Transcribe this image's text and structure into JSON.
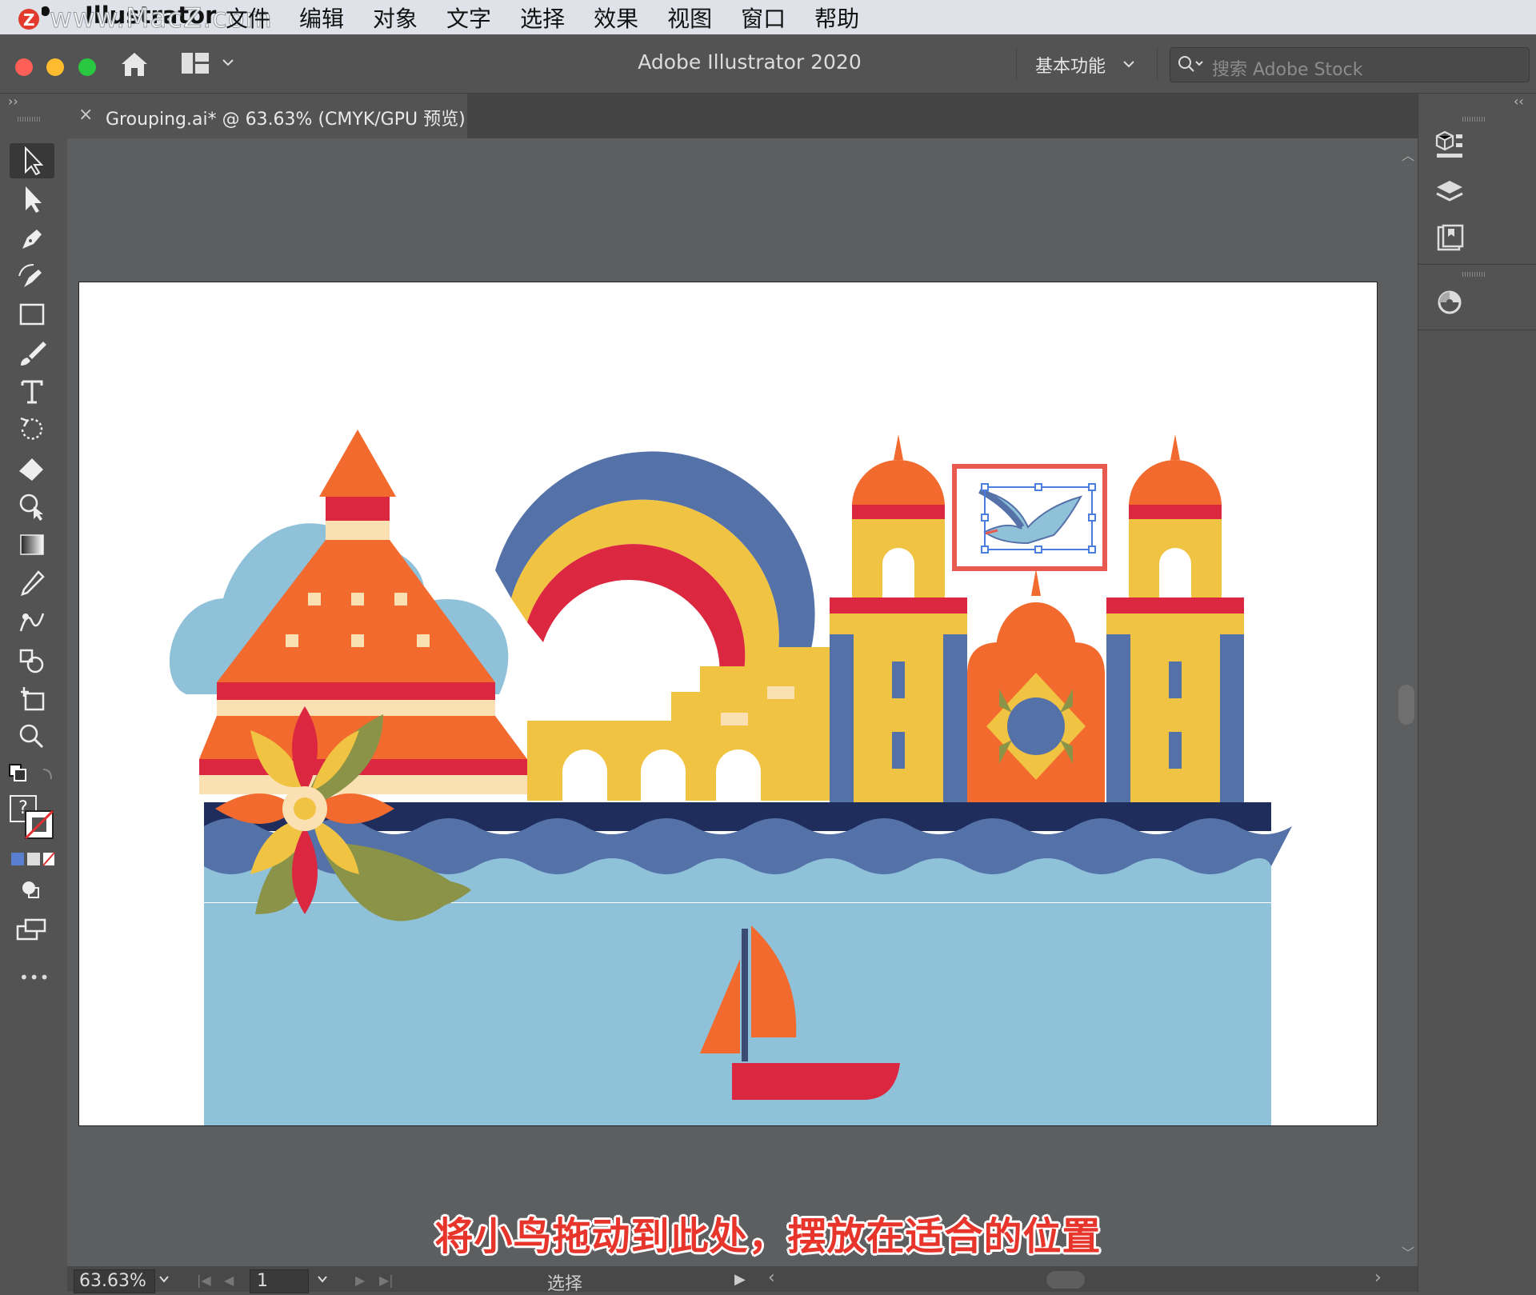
{
  "menubar": {
    "app_name": "Illustrator",
    "watermark": "www.MacZ.com",
    "items": [
      "文件",
      "编辑",
      "对象",
      "文字",
      "选择",
      "效果",
      "视图",
      "窗口",
      "帮助"
    ]
  },
  "titlebar": {
    "window_title": "Adobe Illustrator 2020",
    "workspace": "基本功能",
    "search_placeholder": "搜索 Adobe Stock"
  },
  "document_tab": {
    "close": "×",
    "label": "Grouping.ai* @ 63.63% (CMYK/GPU 预览)"
  },
  "toolbar": {
    "tools": [
      "selection-tool",
      "direct-selection-tool",
      "pen-tool",
      "curvature-tool",
      "rectangle-tool",
      "paintbrush-tool",
      "type-tool",
      "rotate-tool",
      "eraser-tool",
      "shape-builder-tool",
      "gradient-tool",
      "eyedropper-tool",
      "blend-tool",
      "symbol-sprayer-tool",
      "artboard-tool",
      "zoom-tool"
    ],
    "more": "•••",
    "fill_stroke_unknown": "?"
  },
  "right_panel": {
    "icons": [
      "properties-icon",
      "layers-icon",
      "libraries-icon",
      "color-themes-icon"
    ]
  },
  "statusbar": {
    "zoom": "63.63%",
    "page": "1",
    "mode": "选择"
  },
  "caption": "将小鸟拖动到此处，摆放在适合的位置",
  "colors": {
    "orange": "#f26a2e",
    "red": "#dc2740",
    "yellow": "#f1c342",
    "blue": "#5471a8",
    "navy": "#1f2d5c",
    "sky": "#8fc1d9",
    "cream": "#fbe0b4",
    "olive": "#8a9348",
    "highlight": "#e85a4f"
  }
}
